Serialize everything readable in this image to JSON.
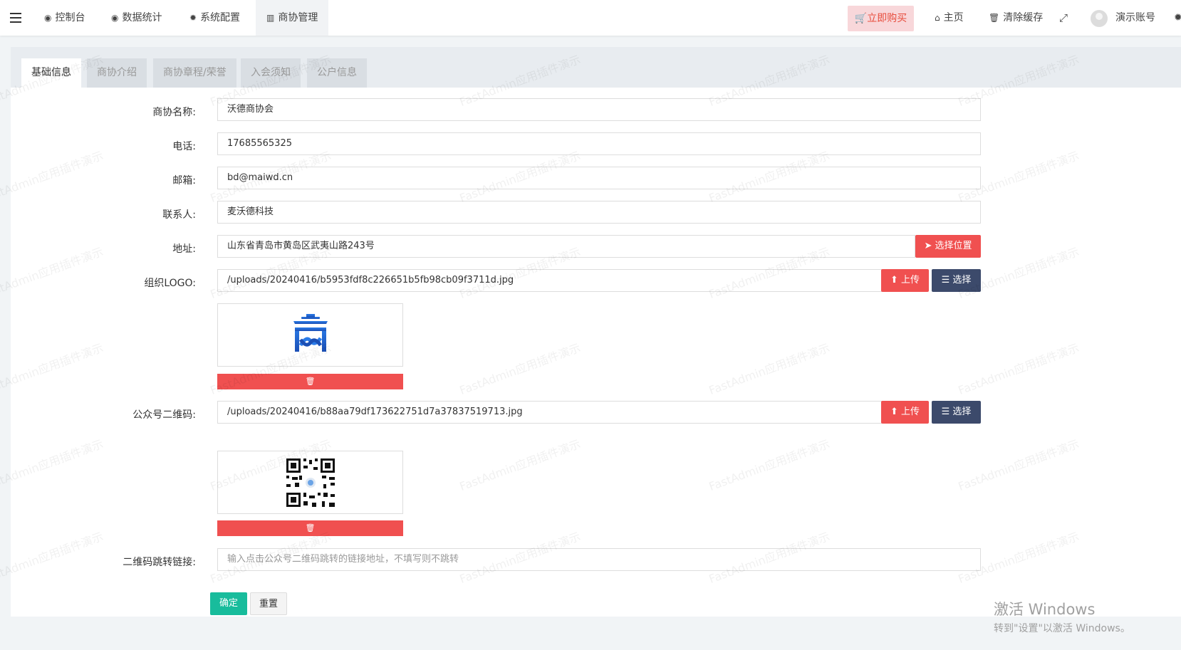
{
  "navbar": {
    "items": [
      {
        "label": "控制台",
        "icon": "dashboard-icon"
      },
      {
        "label": "数据统计",
        "icon": "dashboard-icon"
      },
      {
        "label": "系统配置",
        "icon": "gear-icon"
      },
      {
        "label": "商协管理",
        "icon": "bar-chart-icon"
      }
    ],
    "buy_label": "立即购买",
    "home_label": "主页",
    "clear_cache_label": "清除缓存",
    "account_label": "演示账号"
  },
  "tabs": [
    "基础信息",
    "商协介绍",
    "商协章程/荣誉",
    "入会须知",
    "公户信息"
  ],
  "form": {
    "name": {
      "label": "商协名称:",
      "value": "沃德商协会"
    },
    "phone": {
      "label": "电话:",
      "value": "17685565325"
    },
    "email": {
      "label": "邮箱:",
      "value": "bd@maiwd.cn"
    },
    "contact": {
      "label": "联系人:",
      "value": "麦沃德科技"
    },
    "address": {
      "label": "地址:",
      "value": "山东省青岛市黄岛区武夷山路243号",
      "button": "选择位置"
    },
    "logo": {
      "label": "组织LOGO:",
      "value": "/uploads/20240416/b5953fdf8c226651b5fb98cb09f3711d.jpg",
      "upload": "上传",
      "choose": "选择"
    },
    "qrcode": {
      "label": "公众号二维码:",
      "value": "/uploads/20240416/b88aa79df173622751d7a37837519713.jpg",
      "upload": "上传",
      "choose": "选择"
    },
    "qrlink": {
      "label": "二维码跳转链接:",
      "placeholder": "输入点击公众号二维码跳转的链接地址，不填写则不跳转"
    }
  },
  "actions": {
    "submit": "确定",
    "reset": "重置"
  },
  "watermark": "FastAdmin应用插件演示",
  "windows_activation": {
    "line1": "激活 Windows",
    "line2": "转到\"设置\"以激活 Windows。"
  },
  "colors": {
    "danger": "#f05050",
    "dark": "#3c4a6b",
    "success": "#18bc9c"
  }
}
